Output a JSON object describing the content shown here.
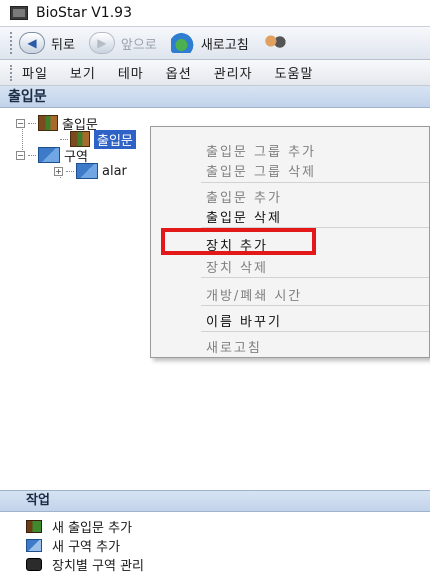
{
  "window": {
    "title": "BioStar V1.93"
  },
  "toolbar": {
    "back_label": "뒤로",
    "forward_label": "앞으로",
    "refresh_label": "새로고침"
  },
  "menubar": {
    "items": [
      "파일",
      "보기",
      "테마",
      "옵션",
      "관리자",
      "도움말"
    ]
  },
  "door_panel": {
    "title": "출입문",
    "tree": {
      "root_door": "출입문",
      "selected_door": "출입문",
      "root_zone": "구역",
      "child_zone": "alar"
    }
  },
  "context_menu": {
    "items": [
      {
        "label": "출입문 그룹 추가",
        "enabled": false
      },
      {
        "label": "출입문 그룹 삭제",
        "enabled": false
      },
      {
        "label": "출입문 추가",
        "enabled": false
      },
      {
        "label": "출입문 삭제",
        "enabled": true
      },
      {
        "label": "장치 추가",
        "enabled": true
      },
      {
        "label": "장치 삭제",
        "enabled": false
      },
      {
        "label": "개방/폐쇄 시간",
        "enabled": false
      },
      {
        "label": "이름 바꾸기",
        "enabled": true
      },
      {
        "label": "새로고침",
        "enabled": false
      }
    ],
    "highlight_color": "#e31818"
  },
  "tasks": {
    "title": "작업",
    "items": [
      {
        "label": "새 출입문 추가",
        "icon": "door-icon"
      },
      {
        "label": "새 구역 추가",
        "icon": "zone-icon"
      },
      {
        "label": "장치별 구역 관리",
        "icon": "device-icon"
      }
    ]
  },
  "colors": {
    "selection": "#2f62c6",
    "panel_header": "#c2d3ea"
  }
}
